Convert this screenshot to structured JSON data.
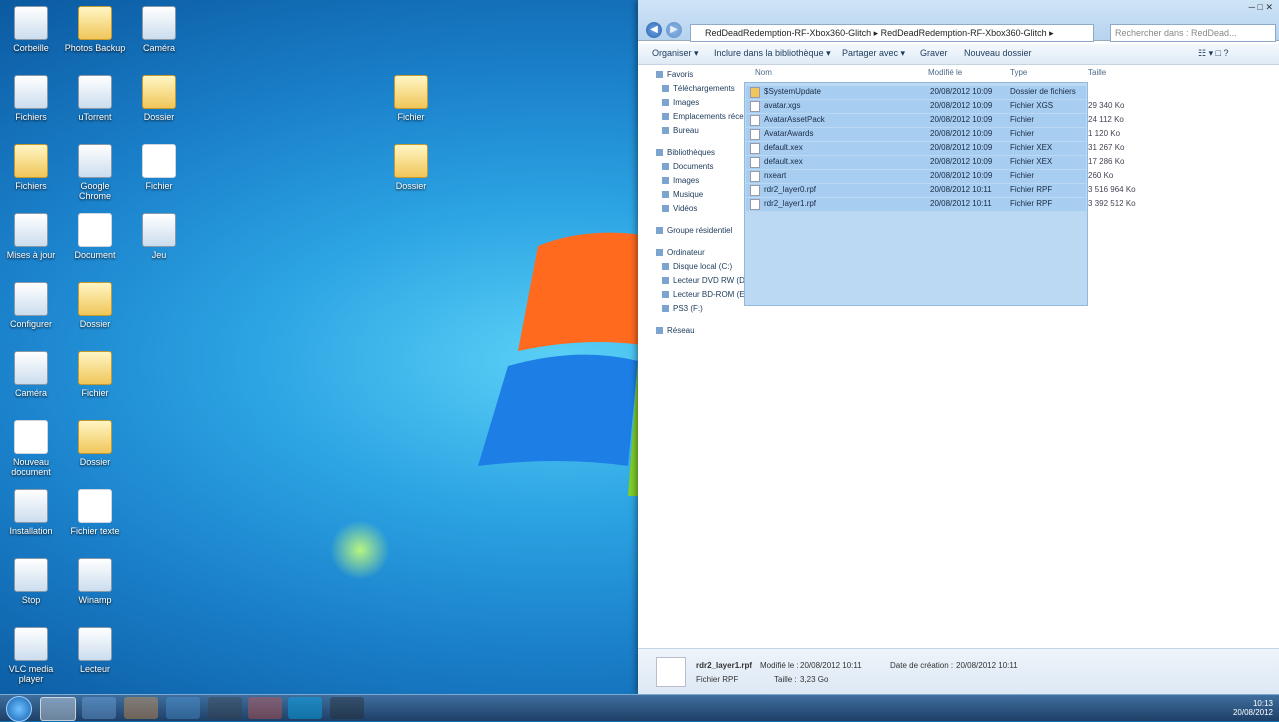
{
  "desktop_icons": [
    {
      "label": "Corbeille",
      "col": 0,
      "row": 0,
      "kind": "app"
    },
    {
      "label": "Fichiers",
      "col": 0,
      "row": 1,
      "kind": "app"
    },
    {
      "label": "Fichiers",
      "col": 0,
      "row": 2,
      "kind": "folder"
    },
    {
      "label": "Mises à jour",
      "col": 0,
      "row": 3,
      "kind": "app"
    },
    {
      "label": "Configurer",
      "col": 0,
      "row": 4,
      "kind": "app"
    },
    {
      "label": "Caméra",
      "col": 0,
      "row": 5,
      "kind": "app"
    },
    {
      "label": "Nouveau document",
      "col": 0,
      "row": 6,
      "kind": "doc"
    },
    {
      "label": "Installation",
      "col": 0,
      "row": 7,
      "kind": "app"
    },
    {
      "label": "Stop",
      "col": 0,
      "row": 8,
      "kind": "app"
    },
    {
      "label": "VLC media player",
      "col": 0,
      "row": 9,
      "kind": "app"
    },
    {
      "label": "Photos Backup",
      "col": 1,
      "row": 0,
      "kind": "folder"
    },
    {
      "label": "uTorrent",
      "col": 1,
      "row": 1,
      "kind": "app"
    },
    {
      "label": "Google Chrome",
      "col": 1,
      "row": 2,
      "kind": "app"
    },
    {
      "label": "Document",
      "col": 1,
      "row": 3,
      "kind": "doc"
    },
    {
      "label": "Dossier",
      "col": 1,
      "row": 4,
      "kind": "folder"
    },
    {
      "label": "Fichier",
      "col": 1,
      "row": 5,
      "kind": "folder"
    },
    {
      "label": "Dossier",
      "col": 1,
      "row": 6,
      "kind": "folder"
    },
    {
      "label": "Fichier texte",
      "col": 1,
      "row": 7,
      "kind": "doc"
    },
    {
      "label": "Winamp",
      "col": 1,
      "row": 8,
      "kind": "app"
    },
    {
      "label": "Lecteur",
      "col": 1,
      "row": 9,
      "kind": "app"
    },
    {
      "label": "Caméra",
      "col": 2,
      "row": 0,
      "kind": "app"
    },
    {
      "label": "Dossier",
      "col": 2,
      "row": 1,
      "kind": "folder"
    },
    {
      "label": "Fichier",
      "col": 2,
      "row": 2,
      "kind": "doc"
    },
    {
      "label": "Jeu",
      "col": 2,
      "row": 3,
      "kind": "app"
    },
    {
      "label": "Fichier",
      "col": 5,
      "row": 1,
      "kind": "folder"
    },
    {
      "label": "Dossier",
      "col": 5,
      "row": 2,
      "kind": "folder"
    }
  ],
  "explorer": {
    "address": "RedDeadRedemption-RF-Xbox360-Glitch ▸ RedDeadRedemption-RF-Xbox360-Glitch ▸",
    "search_placeholder": "Rechercher dans : RedDead...",
    "caption_buttons": "─  □  ✕",
    "back": "◀",
    "forward": "▶",
    "toolbar": [
      "Organiser ▾",
      "Inclure dans la bibliothèque ▾",
      "Partager avec ▾",
      "Graver",
      "Nouveau dossier"
    ],
    "toolbar_right": "☷ ▾  □  ?",
    "nav": [
      {
        "label": "Favoris",
        "indent": 0
      },
      {
        "label": "Téléchargements",
        "indent": 1
      },
      {
        "label": "Images",
        "indent": 1
      },
      {
        "label": "Emplacements récents",
        "indent": 1
      },
      {
        "label": "Bureau",
        "indent": 1
      },
      {
        "label": "Bibliothèques",
        "indent": 0
      },
      {
        "label": "Documents",
        "indent": 1
      },
      {
        "label": "Images",
        "indent": 1
      },
      {
        "label": "Musique",
        "indent": 1
      },
      {
        "label": "Vidéos",
        "indent": 1
      },
      {
        "label": "Groupe résidentiel",
        "indent": 0
      },
      {
        "label": "Ordinateur",
        "indent": 0
      },
      {
        "label": "Disque local (C:)",
        "indent": 1
      },
      {
        "label": "Lecteur DVD RW (D:)",
        "indent": 1
      },
      {
        "label": "Lecteur BD-ROM (E:)",
        "indent": 1
      },
      {
        "label": "PS3 (F:)",
        "indent": 1
      },
      {
        "label": "Réseau",
        "indent": 0
      }
    ],
    "columns": [
      "Nom",
      "Modifié le",
      "Type",
      "Taille"
    ],
    "files": [
      {
        "name": "$SystemUpdate",
        "date": "20/08/2012 10:09",
        "type": "Dossier de fichiers",
        "size": ""
      },
      {
        "name": "avatar.xgs",
        "date": "20/08/2012 10:09",
        "type": "Fichier XGS",
        "size": "29 340 Ko"
      },
      {
        "name": "AvatarAssetPack",
        "date": "20/08/2012 10:09",
        "type": "Fichier",
        "size": "24 112 Ko"
      },
      {
        "name": "AvatarAwards",
        "date": "20/08/2012 10:09",
        "type": "Fichier",
        "size": "1 120 Ko"
      },
      {
        "name": "default.xex",
        "date": "20/08/2012 10:09",
        "type": "Fichier XEX",
        "size": "31 267 Ko"
      },
      {
        "name": "default.xex",
        "date": "20/08/2012 10:09",
        "type": "Fichier XEX",
        "size": "17 286 Ko"
      },
      {
        "name": "nxeart",
        "date": "20/08/2012 10:09",
        "type": "Fichier",
        "size": "260 Ko"
      },
      {
        "name": "rdr2_layer0.rpf",
        "date": "20/08/2012 10:11",
        "type": "Fichier RPF",
        "size": "3 516 964 Ko"
      },
      {
        "name": "rdr2_layer1.rpf",
        "date": "20/08/2012 10:11",
        "type": "Fichier RPF",
        "size": "3 392 512 Ko"
      }
    ],
    "details": {
      "title": "rdr2_layer1.rpf",
      "modified_label": "Modifié le :",
      "modified": "20/08/2012 10:11",
      "created_label": "Date de création :",
      "created": "20/08/2012 10:11",
      "type": "Fichier RPF",
      "size_label": "Taille :",
      "size": "3,23 Go"
    }
  },
  "taskbar": {
    "items": [
      "start",
      "explorer",
      "ie",
      "media-player",
      "explorer-window",
      "chrome",
      "skype",
      "skype-2",
      "game"
    ],
    "time": "10:13",
    "date": "20/08/2012"
  }
}
